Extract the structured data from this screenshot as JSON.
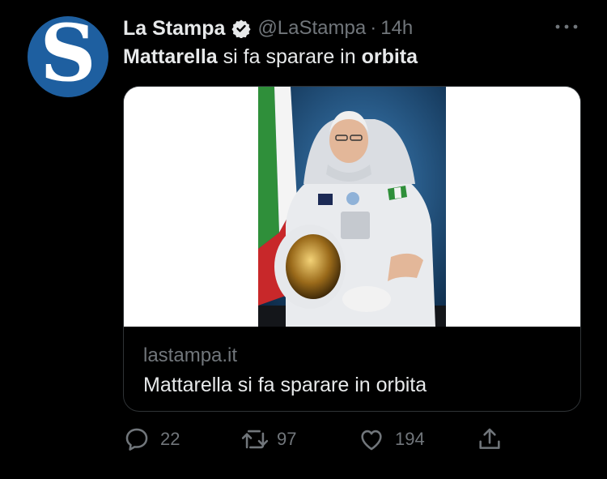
{
  "tweet": {
    "avatar_letter": "S",
    "author_name": "La Stampa",
    "handle": "@LaStampa",
    "separator": "·",
    "time": "14h",
    "text_bold_1": "Mattarella",
    "text_mid": " si fa sparare in ",
    "text_bold_2": "orbita"
  },
  "card": {
    "domain": "lastampa.it",
    "title": "Mattarella si fa sparare in orbita"
  },
  "actions": {
    "replies": "22",
    "retweets": "97",
    "likes": "194"
  },
  "icons": {
    "verified": "verified-badge-icon",
    "more": "more-dots-icon",
    "reply": "reply-icon",
    "retweet": "retweet-icon",
    "like": "heart-icon",
    "share": "share-icon"
  },
  "colors": {
    "background": "#000000",
    "primary_text": "#e7e9ea",
    "secondary_text": "#71767b",
    "border": "#2f3336",
    "avatar_bg": "#1e5fa0"
  }
}
